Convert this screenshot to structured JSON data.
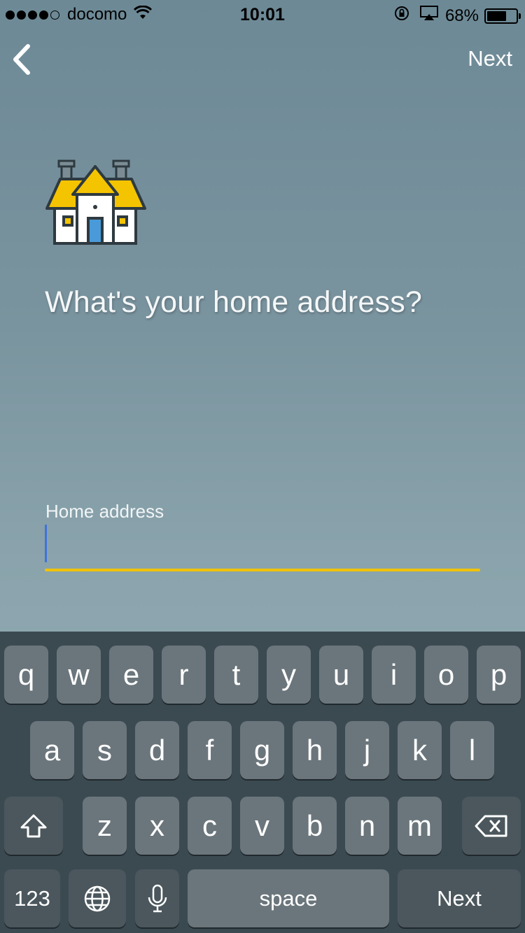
{
  "status_bar": {
    "carrier": "docomo",
    "time": "10:01",
    "battery_percent": "68%",
    "battery_level": 0.68,
    "signal_bars": 4
  },
  "nav": {
    "back_icon": "chevron-left-icon",
    "next_label": "Next"
  },
  "hero": {
    "icon": "house-icon",
    "question": "What's your home address?"
  },
  "address_field": {
    "label": "Home address",
    "value": "",
    "accent_color": "#f2c200"
  },
  "keyboard": {
    "row1": [
      "q",
      "w",
      "e",
      "r",
      "t",
      "y",
      "u",
      "i",
      "o",
      "p"
    ],
    "row2": [
      "a",
      "s",
      "d",
      "f",
      "g",
      "h",
      "j",
      "k",
      "l"
    ],
    "row3": [
      "z",
      "x",
      "c",
      "v",
      "b",
      "n",
      "m"
    ],
    "numbers_label": "123",
    "space_label": "space",
    "return_label": "Next",
    "shift_icon": "shift-icon",
    "delete_icon": "backspace-icon",
    "globe_icon": "globe-icon",
    "mic_icon": "microphone-icon"
  }
}
